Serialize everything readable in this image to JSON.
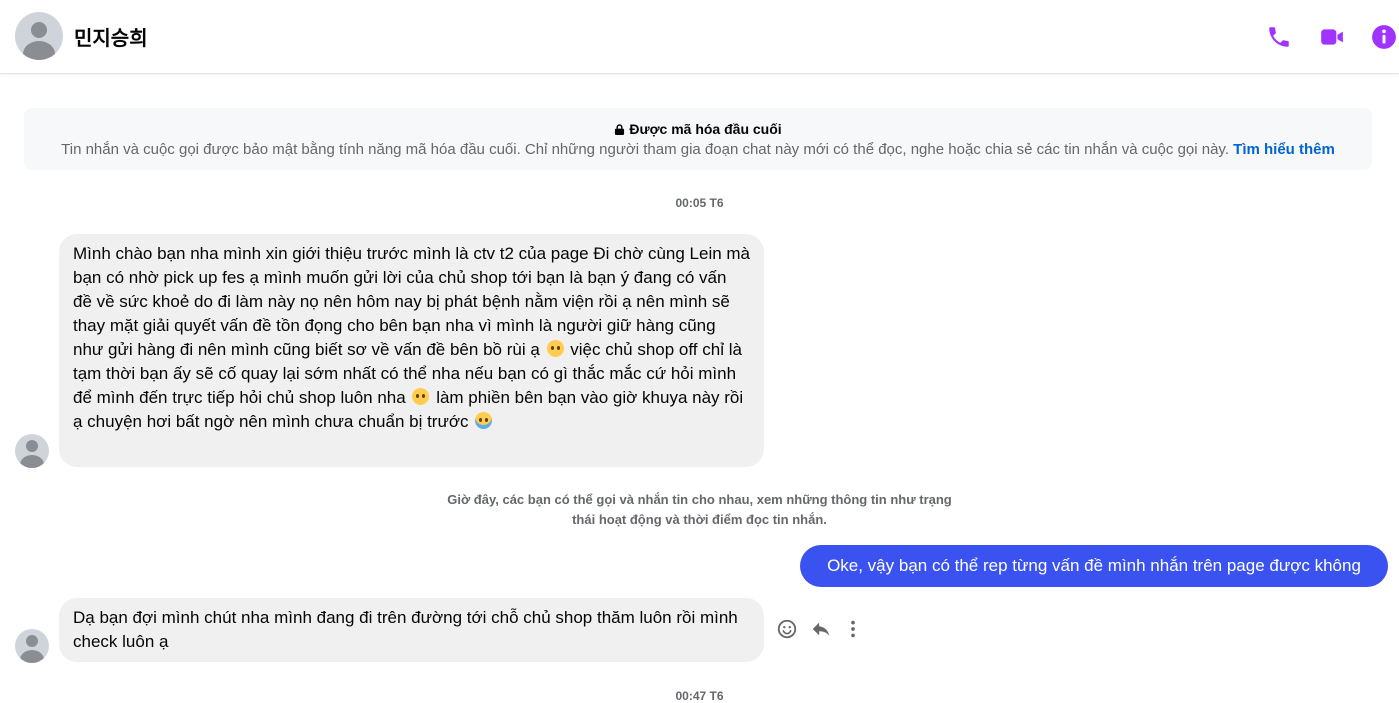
{
  "header": {
    "contact_name": "민지승희",
    "icons": [
      "phone-icon",
      "video-icon",
      "info-icon"
    ],
    "accent_color": "#a033ff"
  },
  "e2ee_notice": {
    "title": "Được mã hóa đầu cuối",
    "text": "Tin nhắn và cuộc gọi được bảo mật bằng tính năng mã hóa đầu cuối. Chỉ những người tham gia đoạn chat này mới có thể đọc, nghe hoặc chia sẻ các tin nhắn và cuộc gọi này.",
    "link_label": "Tìm hiểu thêm"
  },
  "messages": {
    "timestamp_1": "00:05 T6",
    "incoming_1": {
      "part1": "Mình chào bạn nha mình xin giới thiệu trước mình là ctv t2 của page Đi chờ cùng Lein mà bạn có nhờ pick up fes ạ mình muốn gửi lời của chủ shop tới bạn là bạn ý đang có vấn đề về sức khoẻ do đi làm này nọ nên hôm nay bị phát bệnh nằm viện rồi ạ nên mình sẽ thay mặt giải quyết vấn đề tồn đọng cho bên bạn nha vì mình là người giữ hàng cũng như gửi hàng đi nên mình cũng biết sơ về vấn đề bên bồ rùi ạ",
      "part2": "việc chủ shop off chỉ là tạm thời bạn ấy sẽ cố quay lại sớm nhất có thể nha nếu bạn có gì thắc mắc cứ hỏi mình để mình đến trực tiếp hỏi chủ shop luôn nha",
      "part3": "làm phiền bên bạn vào giờ khuya này rồi ạ chuyện hơi bất ngờ nên mình chưa chuẩn bị trước"
    },
    "system_note_line1": "Giờ đây, các bạn có thể gọi và nhắn tin cho nhau, xem những thông tin như trạng",
    "system_note_line2": "thái hoạt động và thời điểm đọc tin nhắn.",
    "outgoing_1": "Oke, vậy bạn có thể rep từng vấn đề mình nhắn trên page được không",
    "incoming_2": "Dạ bạn đợi mình chút nha mình đang đi trên đường tới chỗ chủ shop thăm luôn rồi mình check luôn ạ",
    "timestamp_2": "00:47 T6",
    "outgoing_bubble_color": "#3a52ef"
  },
  "message_actions": [
    "smiley-icon",
    "reply-icon",
    "more-icon"
  ]
}
